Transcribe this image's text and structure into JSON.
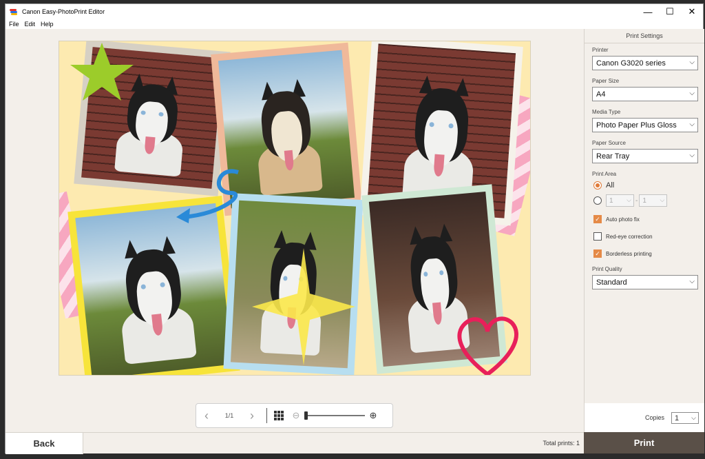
{
  "window": {
    "title": "Canon Easy-PhotoPrint Editor"
  },
  "menu": {
    "items": [
      "File",
      "Edit",
      "Help"
    ]
  },
  "window_controls": {
    "minimize": "—",
    "maximize": "☐",
    "close": "✕"
  },
  "toolbar": {
    "prev": "‹",
    "page_indicator": "1/1",
    "next": "›",
    "zoom_level": 0
  },
  "footer": {
    "back_label": "Back",
    "total_prints": "Total prints: 1"
  },
  "settings": {
    "title": "Print Settings",
    "printer": {
      "label": "Printer",
      "value": "Canon G3020 series"
    },
    "paper_size": {
      "label": "Paper Size",
      "value": "A4"
    },
    "media_type": {
      "label": "Media Type",
      "value": "Photo Paper Plus Gloss"
    },
    "paper_source": {
      "label": "Paper Source",
      "value": "Rear Tray"
    },
    "print_area": {
      "label": "Print Area",
      "all_label": "All",
      "range_from": "1",
      "range_sep": "-",
      "range_to": "1"
    },
    "auto_photo_fix": {
      "label": "Auto photo fix",
      "checked": true
    },
    "red_eye": {
      "label": "Red-eye correction",
      "checked": false
    },
    "borderless": {
      "label": "Borderless printing",
      "checked": true
    },
    "print_quality": {
      "label": "Print Quality",
      "value": "Standard"
    },
    "copies": {
      "label": "Copies",
      "value": "1"
    },
    "print_label": "Print"
  },
  "colors": {
    "accent": "#e58a47",
    "print_button": "#5a5048",
    "page_bg": "#fdeab0"
  }
}
